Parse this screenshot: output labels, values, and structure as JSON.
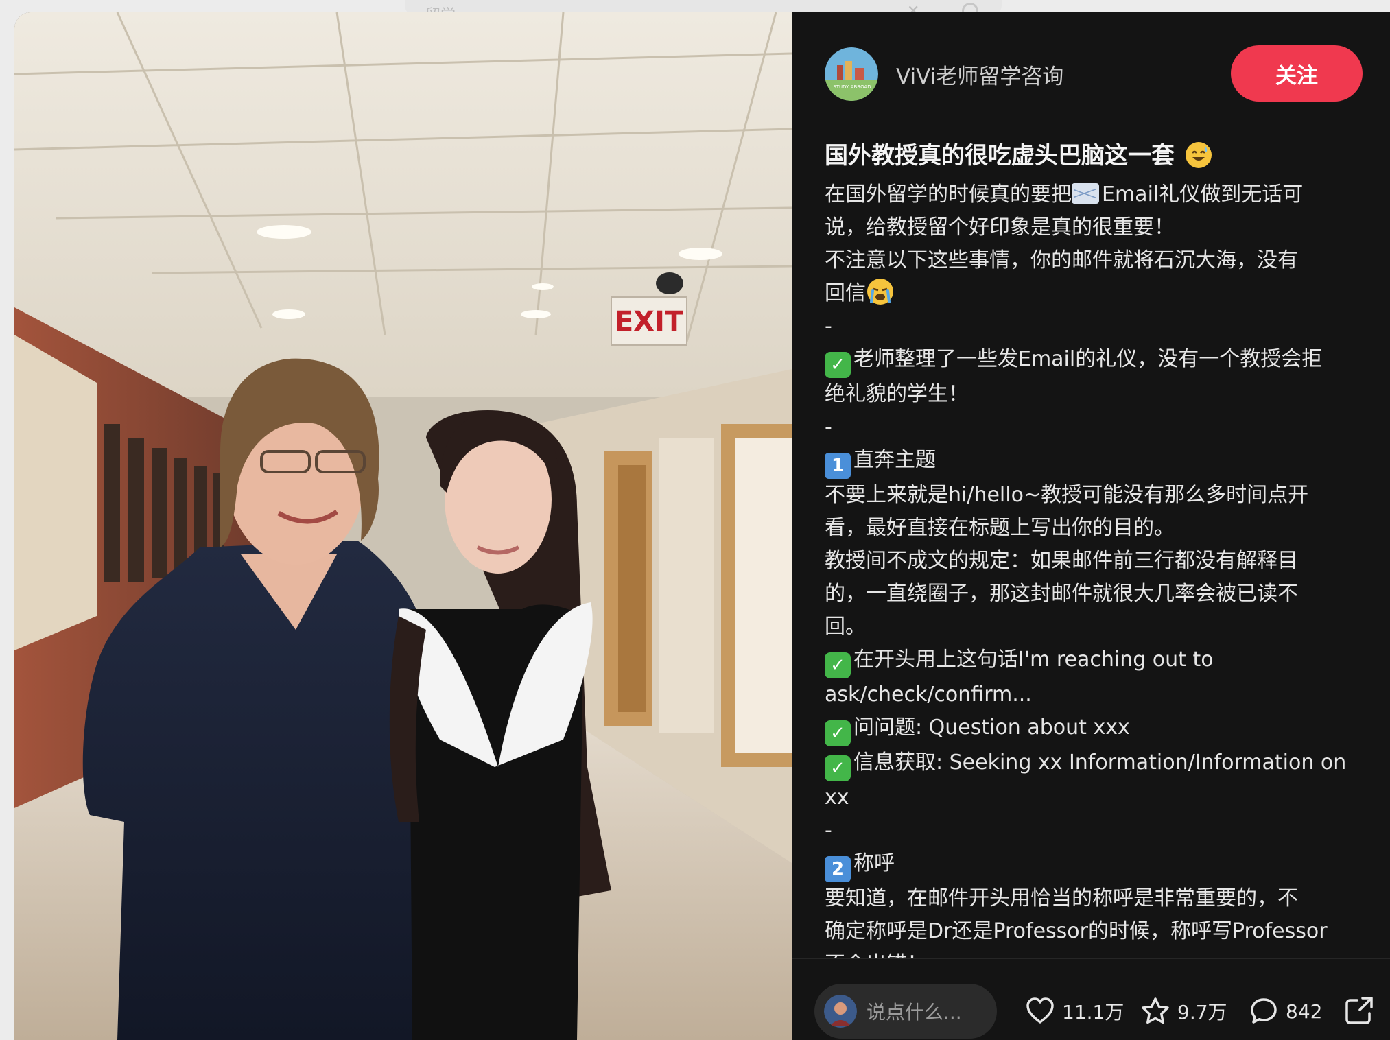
{
  "background": {
    "header_text": "留学"
  },
  "author": {
    "name": "ViVi老师留学咨询",
    "avatar_text": "STUDY ABROAD",
    "follow_label": "关注"
  },
  "post": {
    "title": "国外教授真的很吃虚头巴脑这一套",
    "lines": [
      {
        "pre": "在国外留学的时候真的要把",
        "emoji": "mail",
        "text": "Email礼仪做到无话可"
      },
      {
        "text": "说，给教授留个好印象是真的很重要！"
      },
      {
        "text": "不注意以下这些事情，你的邮件就将石沉大海，没有"
      },
      {
        "text": "回信",
        "emoji_after": "face-cry"
      },
      {
        "text": "-"
      },
      {
        "emoji": "check",
        "text": "老师整理了一些发Email的礼仪，没有一个教授会拒"
      },
      {
        "text": "绝礼貌的学生！"
      },
      {
        "text": "-"
      },
      {
        "emoji": "num",
        "num": "1",
        "text": "直奔主题"
      },
      {
        "text": "不要上来就是hi/hello~教授可能没有那么多时间点开"
      },
      {
        "text": "看，最好直接在标题上写出你的目的。"
      },
      {
        "text": "教授间不成文的规定：如果邮件前三行都没有解释目"
      },
      {
        "text": "的，一直绕圈子，那这封邮件就很大几率会被已读不"
      },
      {
        "text": "回。"
      },
      {
        "emoji": "check",
        "text": "在开头用上这句话I'm reaching out to"
      },
      {
        "text": "ask/check/confirm..."
      },
      {
        "emoji": "check",
        "text": "问问题: Question about xxx"
      },
      {
        "emoji": "check",
        "text": "信息获取: Seeking xx Information/Information on"
      },
      {
        "text": "xx"
      },
      {
        "text": "-"
      },
      {
        "emoji": "num",
        "num": "2",
        "text": "称呼"
      },
      {
        "text": "要知道，在邮件开头用恰当的称呼是非常重要的，不"
      },
      {
        "text": "确定称呼是Dr还是Professor的时候，称呼写Professor"
      },
      {
        "text": "不会出错！"
      }
    ]
  },
  "photo": {
    "exit_sign": "EXIT"
  },
  "footer": {
    "comment_placeholder": "说点什么...",
    "likes": "11.1万",
    "favorites": "9.7万",
    "comments": "842"
  },
  "colors": {
    "accent": "#f0394f",
    "panel_bg": "#141414"
  }
}
